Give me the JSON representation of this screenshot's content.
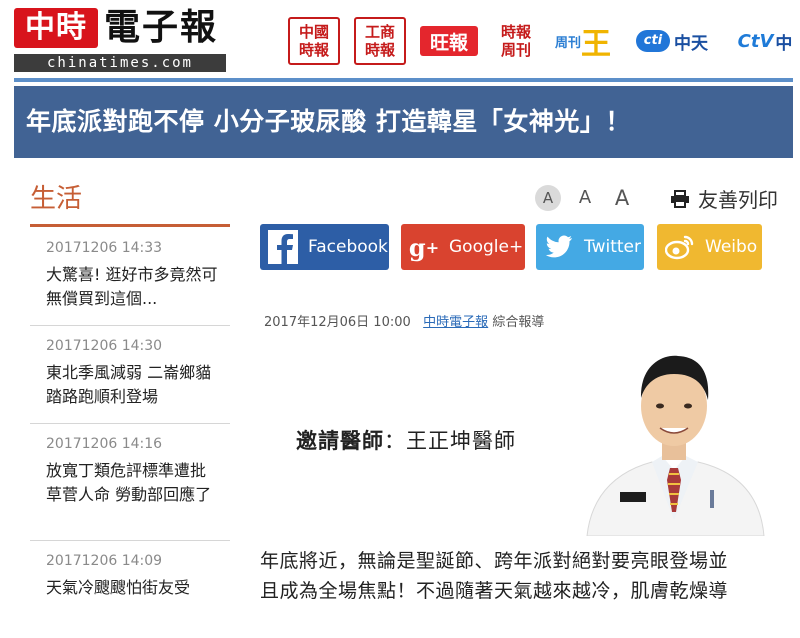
{
  "logo": {
    "red_text": "中時",
    "black_text": "電子報",
    "domain": "chinatimes.com"
  },
  "partners": [
    {
      "name": "ct-logo",
      "line1": "中國",
      "line2": "時報"
    },
    {
      "name": "commercial-times-logo",
      "line1": "工商",
      "line2": "時報"
    },
    {
      "name": "want-daily-logo",
      "text": "旺報"
    },
    {
      "name": "times-weekly-logo",
      "line1": "時報",
      "line2": "周刊"
    },
    {
      "name": "king-logo",
      "text": "周刊",
      "mark": "王"
    },
    {
      "name": "ctitv-logo",
      "badge": "cti",
      "text": "中天"
    },
    {
      "name": "ctv-logo",
      "badge": "CtV",
      "text": "中"
    }
  ],
  "headline": "年底派對跑不停 小分子玻尿酸 打造韓星「女神光」！",
  "sidebar": {
    "title": "生活",
    "items": [
      {
        "time": "20171206 14:33",
        "title": "大驚喜! 逛好市多竟然可無償買到這個..."
      },
      {
        "time": "20171206 14:30",
        "title": "東北季風減弱 二崙鄉貓踏路跑順利登場"
      },
      {
        "time": "20171206 14:16",
        "title": "放寬丁類危評標準遭批草菅人命 勞動部回應了"
      },
      {
        "time": "20171206 14:09",
        "title": "天氣冷颼颼怕街友受"
      }
    ]
  },
  "tools": {
    "font_small": "A",
    "font_medium": "A",
    "font_large": "A",
    "print": "友善列印"
  },
  "share": {
    "facebook": "Facebook",
    "google": "Google+",
    "twitter": "Twitter",
    "weibo": "Weibo"
  },
  "article": {
    "date": "2017年12月06日 10:00",
    "source_link": "中時電子報",
    "source_note": "綜合報導",
    "doctor_prefix": "邀請醫師",
    "doctor_name": "：王正坤醫師",
    "body_line1": "年底將近，無論是聖誕節、跨年派對絕對要亮眼登場並",
    "body_line2": "且成為全場焦點！不過隨著天氣越來越冷，肌膚乾燥導"
  },
  "colors": {
    "title_band": "#416394",
    "accent_orange": "#c65e35",
    "brand_red": "#d8141c",
    "link_blue": "#2b6bb8"
  }
}
